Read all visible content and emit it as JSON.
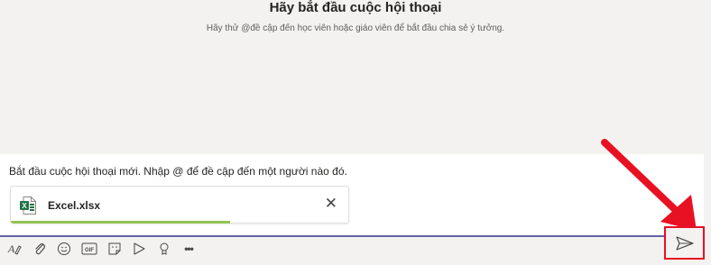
{
  "header": {
    "title": "Hãy bắt đầu cuộc hội thoại",
    "subtitle": "Hãy thử @đề cập đến học viên hoặc giáo viên để bắt đầu chia sẻ ý tưởng."
  },
  "compose": {
    "placeholder": "Bắt đầu cuộc hội thoại mới. Nhập @ để đề cập đến một người nào đó.",
    "attachment": {
      "file_name": "Excel.xlsx",
      "file_icon": "excel-file-icon",
      "upload_progress": 0.65
    }
  },
  "toolbar": {
    "icons": [
      "format-icon",
      "attach-icon",
      "emoji-icon",
      "gif-icon",
      "sticker-icon",
      "meet-icon",
      "praise-icon",
      "more-icon"
    ],
    "gif_label": "GIF",
    "more_label": "•••"
  },
  "send": {
    "icon": "send-icon"
  },
  "colors": {
    "accent": "#6264a7",
    "excel_green": "#217346",
    "progress_green": "#92c353",
    "highlight_red": "#e81123"
  }
}
